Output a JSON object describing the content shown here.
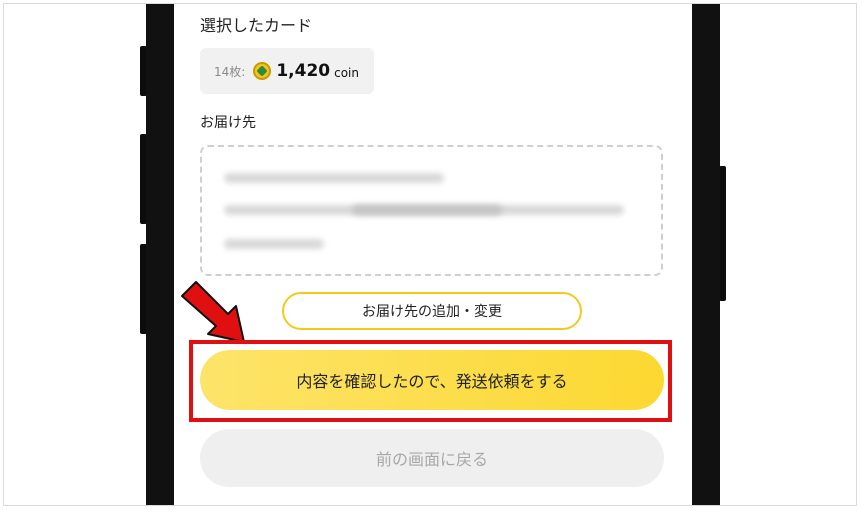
{
  "selected_cards": {
    "title": "選択したカード",
    "count_label": "14枚:",
    "coin_value": "1,420",
    "coin_unit": "coin"
  },
  "delivery": {
    "title": "お届け先",
    "add_change_label": "お届け先の追加・変更"
  },
  "actions": {
    "confirm_label": "内容を確認したので、発送依頼をする",
    "back_label": "前の画面に戻る"
  },
  "colors": {
    "accent_yellow": "#fcd830",
    "highlight_red": "#e01010",
    "arrow_red": "#e01010"
  }
}
